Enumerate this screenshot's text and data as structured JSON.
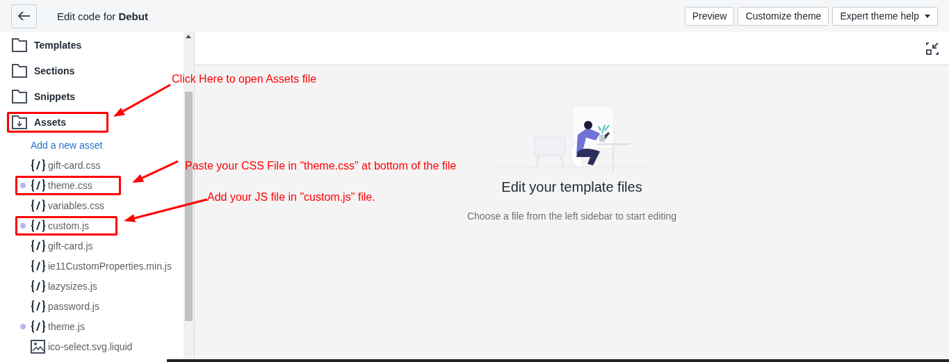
{
  "header": {
    "title": "Edit code for **Debut**",
    "buttons": [
      {
        "label": "Preview",
        "kind": "plain"
      },
      {
        "label": "Customize theme",
        "kind": "plain"
      },
      {
        "label": "Expert theme help",
        "kind": "dropdown"
      }
    ]
  },
  "sidebar": {
    "items": [
      {
        "kind": "folder",
        "label": "Templates",
        "highlighted": false
      },
      {
        "kind": "folder",
        "label": "Sections",
        "highlighted": false
      },
      {
        "kind": "folder",
        "label": "Snippets",
        "highlighted": false
      },
      {
        "kind": "folder-open",
        "label": "Assets",
        "highlighted": true
      },
      {
        "kind": "link",
        "label": "Add a new asset"
      },
      {
        "kind": "code",
        "label": "gift-card.css",
        "modified": false,
        "highlighted": false
      },
      {
        "kind": "code",
        "label": "theme.css",
        "modified": true,
        "highlighted": true
      },
      {
        "kind": "code",
        "label": "variables.css",
        "modified": false,
        "highlighted": false
      },
      {
        "kind": "code",
        "label": "custom.js",
        "modified": true,
        "highlighted": true
      },
      {
        "kind": "code",
        "label": "gift-card.js",
        "modified": false,
        "highlighted": false
      },
      {
        "kind": "code",
        "label": "ie11CustomProperties.min.js",
        "modified": false,
        "highlighted": false
      },
      {
        "kind": "code",
        "label": "lazysizes.js",
        "modified": false,
        "highlighted": false
      },
      {
        "kind": "code",
        "label": "password.js",
        "modified": false,
        "highlighted": false
      },
      {
        "kind": "code",
        "label": "theme.js",
        "modified": true,
        "highlighted": false
      },
      {
        "kind": "image",
        "label": "ico-select.svg.liquid",
        "modified": false,
        "highlighted": false
      }
    ]
  },
  "empty_state": {
    "title": "Edit your template files",
    "text": "Choose a file from the left sidebar to start editing"
  },
  "annotations": [
    "Click Here to open Assets file",
    "Paste your CSS File in \"theme.css\" at bottom of the file",
    "Add your JS file in \"custom.js\" file."
  ]
}
